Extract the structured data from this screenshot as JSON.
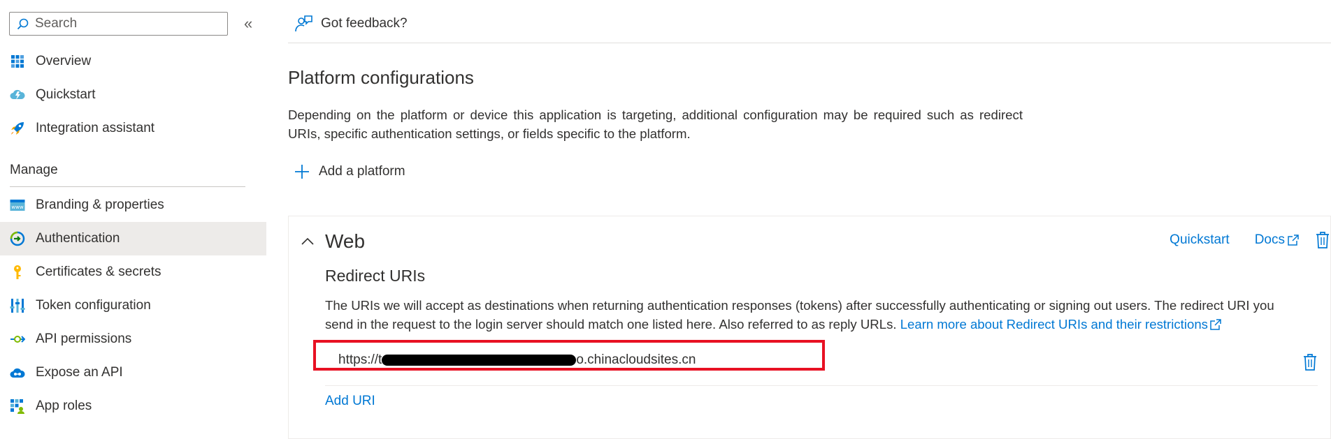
{
  "sidebar": {
    "search_placeholder": "Search",
    "collapse_icon": "«",
    "items_top": [
      {
        "label": "Overview",
        "icon": "grid-icon"
      },
      {
        "label": "Quickstart",
        "icon": "cloud-lightning-icon"
      },
      {
        "label": "Integration assistant",
        "icon": "rocket-icon"
      }
    ],
    "section_header": "Manage",
    "items_manage": [
      {
        "label": "Branding & properties",
        "icon": "www-icon"
      },
      {
        "label": "Authentication",
        "icon": "auth-arrow-icon",
        "active": true
      },
      {
        "label": "Certificates & secrets",
        "icon": "key-icon"
      },
      {
        "label": "Token configuration",
        "icon": "token-bars-icon"
      },
      {
        "label": "API permissions",
        "icon": "api-arrow-icon"
      },
      {
        "label": "Expose an API",
        "icon": "cloud-api-icon"
      },
      {
        "label": "App roles",
        "icon": "app-roles-icon"
      }
    ]
  },
  "main": {
    "feedback_label": "Got feedback?",
    "heading": "Platform configurations",
    "description": "Depending on the platform or device this application is targeting, additional configuration may be required such as redirect URIs, specific authentication settings, or fields specific to the platform.",
    "add_platform_label": "Add a platform",
    "card": {
      "title": "Web",
      "quickstart_link": "Quickstart",
      "docs_link": "Docs",
      "redirect_title": "Redirect URIs",
      "redirect_desc": "The URIs we will accept as destinations when returning authentication responses (tokens) after successfully authenticating or signing out users. The redirect URI you send in the request to the login server should match one listed here. Also referred to as reply URLs. ",
      "redirect_link": "Learn more about Redirect URIs and their restrictions",
      "uri_prefix": "https://t",
      "uri_suffix": "o.chinacloudsites.cn",
      "add_uri_label": "Add URI"
    }
  },
  "colors": {
    "accent": "#0078d4",
    "active_bg": "#edebe9",
    "highlight": "#e81123"
  }
}
